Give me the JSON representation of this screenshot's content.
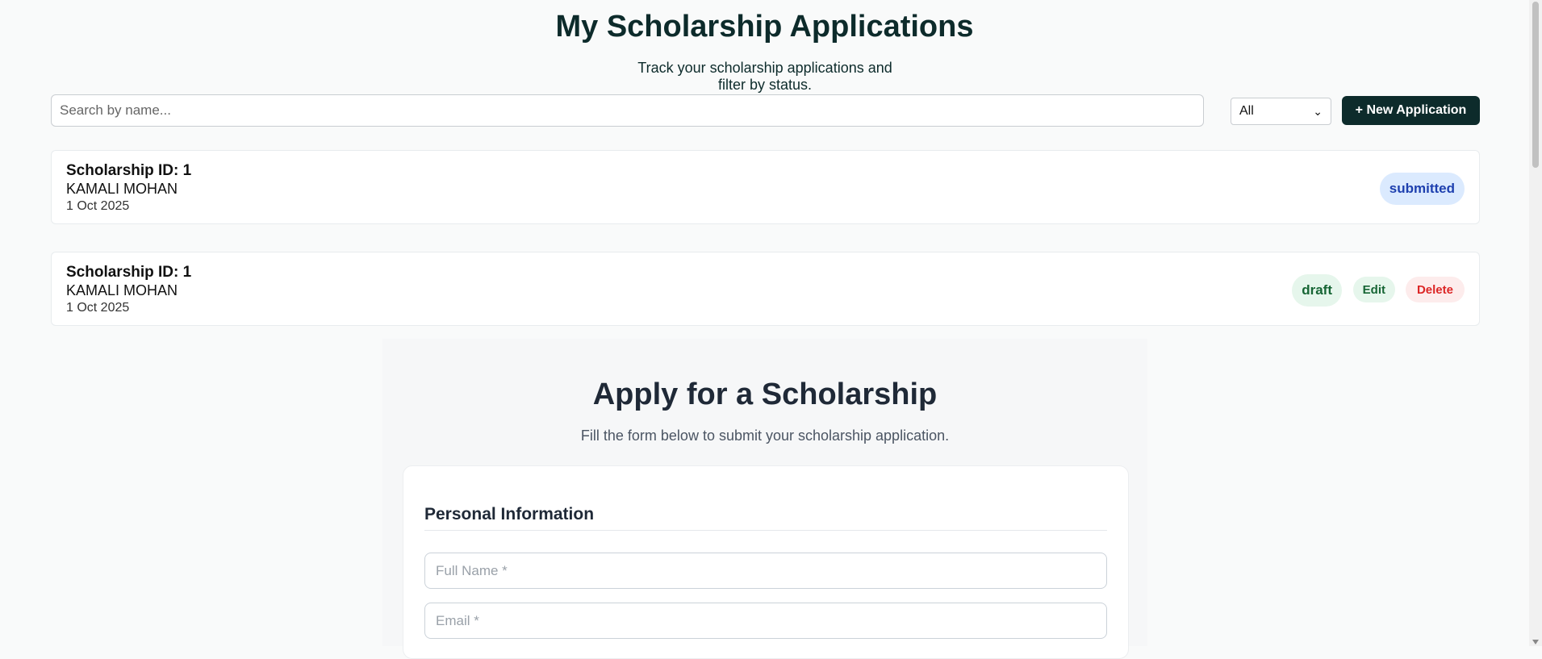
{
  "header": {
    "title": "My Scholarship Applications",
    "subtitle_line1": "Track your scholarship applications and",
    "subtitle_line2": "filter by status."
  },
  "toolbar": {
    "search_placeholder": "Search by name...",
    "status_filter_value": "All",
    "new_application_label": "+ New Application",
    "chevron_icon": "chevron-down-icon"
  },
  "applications": [
    {
      "title": "Scholarship ID: 1",
      "name": "KAMALI MOHAN",
      "date": "1 Oct 2025",
      "status": "submitted"
    },
    {
      "title": "Scholarship ID: 1",
      "name": "KAMALI MOHAN",
      "date": "1 Oct 2025",
      "status": "draft",
      "edit_label": "Edit",
      "delete_label": "Delete"
    }
  ],
  "apply_form": {
    "title": "Apply for a Scholarship",
    "subtitle": "Fill the form below to submit your scholarship application.",
    "section_title": "Personal Information",
    "full_name_placeholder": "Full Name *",
    "email_placeholder": "Email *"
  },
  "colors": {
    "primary_dark": "#0d2b2b",
    "submitted_bg": "#dbeafe",
    "submitted_text": "#1e40af",
    "draft_bg": "#e6f6ec",
    "draft_text": "#166534",
    "delete_text": "#dc2626"
  }
}
